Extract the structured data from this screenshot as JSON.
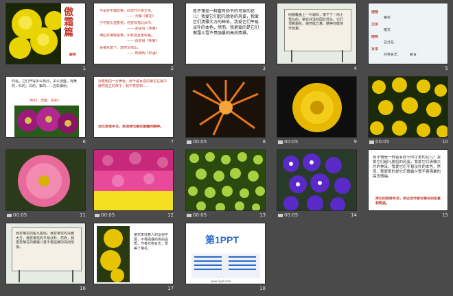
{
  "slides": [
    {
      "num": "1",
      "timing": ""
    },
    {
      "num": "2",
      "timing": ""
    },
    {
      "num": "3",
      "timing": ""
    },
    {
      "num": "4",
      "timing": ""
    },
    {
      "num": "5",
      "timing": ""
    },
    {
      "num": "6",
      "timing": ""
    },
    {
      "num": "7",
      "timing": ""
    },
    {
      "num": "8",
      "timing": "00:05"
    },
    {
      "num": "9",
      "timing": "00:05"
    },
    {
      "num": "10",
      "timing": "00:05"
    },
    {
      "num": "11",
      "timing": "00:05"
    },
    {
      "num": "12",
      "timing": "00:05"
    },
    {
      "num": "13",
      "timing": "00:05"
    },
    {
      "num": "14",
      "timing": "00:05"
    },
    {
      "num": "15",
      "timing": ""
    },
    {
      "num": "16",
      "timing": ""
    },
    {
      "num": "17",
      "timing": ""
    },
    {
      "num": "18",
      "timing": ""
    }
  ],
  "s1": {
    "title": "傲霜篇",
    "author": "峻青"
  },
  "s2": {
    "lines": [
      "不是花中偏爱菊，此花开尽更无花。",
      "—— 元稹《菊花》",
      "宁可枝头抱香死，何曾吹落北风中。",
      "—— 郑思肖《寒菊》",
      "满园花菊郁金黄，中有孤丛色似霜。",
      "—— 白居易《咏菊》",
      "采菊东篱下，悠然见南山。",
      "—— 陶渊明《饮酒》"
    ]
  },
  "s3": {
    "text": "真不愧是一种富有骄节的可爱的花儿！我爱它们超凡脱俗的风姿，我爱它们清雅大方的神采，我爱它们平易淡朴的本色，然而，我更爱的是它们傲霜斗雪不畏强暴的高尚情操。"
  },
  "s4": {
    "text": "树面覆盖上一片霜白，像下了一场小雪似的。菊花并没有因此低头，它们顶着霜花，傲然挺立着，精神抖擞地开放着。"
  },
  "s5": {
    "labels": [
      "借物",
      "文体",
      "结构",
      "写法",
      "作者"
    ],
    "texts": [
      "菊花",
      "散文",
      "总分总",
      "托物言志",
      "峻青"
    ]
  },
  "s6": {
    "text": "你看，它们开得多么热烈，多么茂盛。有黄的，红的，白的，紫的……五彩缤纷。",
    "highlight": "（热烈、茂盛、多彩）"
  },
  "s7": {
    "text": "对着眼前一片黄色，那千姿百态的菊花在霜中傲然挺立的样子，我不禁想到……",
    "highlight": "对比表现手法，更加突出菊花傲霜的精神。"
  },
  "s15": {
    "text": "真不愧是一种富有骄节的可爱的花儿！我爱它们超凡脱俗的风姿，我爱它们清雅大方的神采，我爱它们平易淡朴的本色，然而，我更爱的是它们傲霜斗雪不畏强暴的高尚情操。",
    "highlight": "排比的修辞手法，表达出作者对菊花的爱慕和赞美。"
  },
  "s16": {
    "text": "我爱菊花的超凡脱俗，我爱菊花的清雅大方，我爱菊花的平易淡朴，然而，我更爱菊花的傲霜斗雪不畏强暴的高尚情操。"
  },
  "s17": {
    "text": "菊花象征着人的坚强不屈，不畏强暴的高尚品质。作者托物言志，赞美了菊花。"
  },
  "s18": {
    "logo": "第1PPT",
    "site": "www.1ppt.com"
  },
  "colors": {
    "background": "#4a4a4a",
    "accent": "#c0392b",
    "chalk": "#f4f0e6"
  }
}
